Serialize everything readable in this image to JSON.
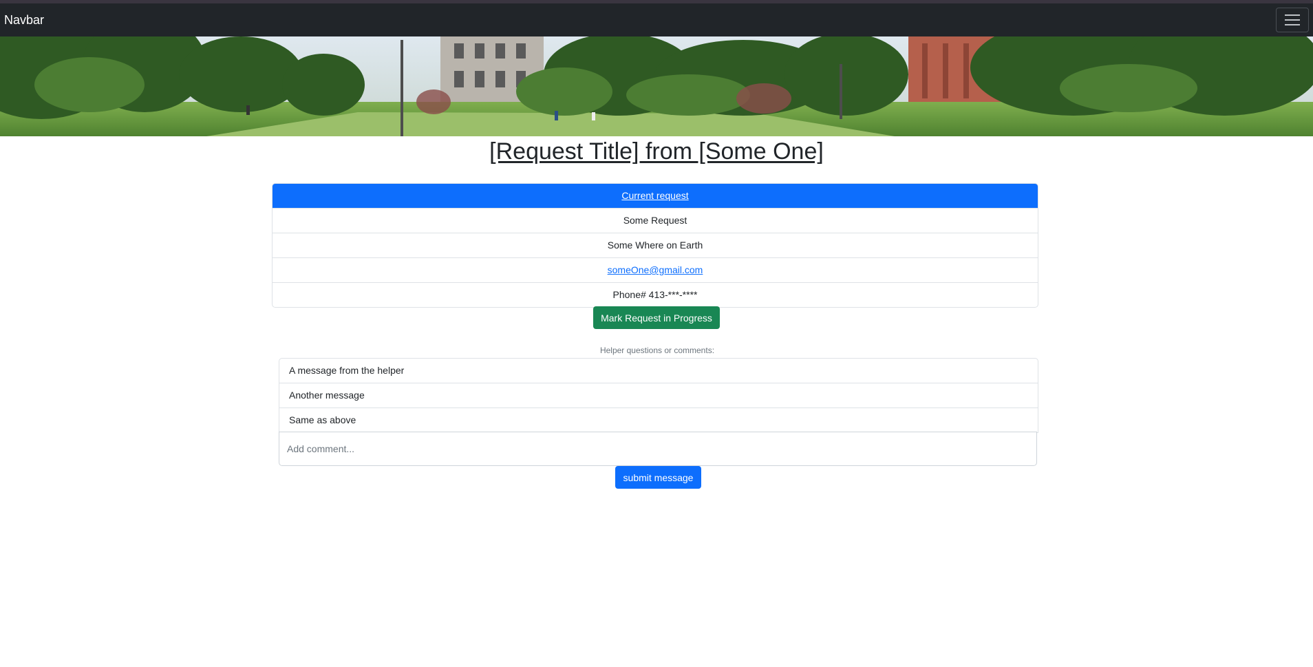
{
  "navbar": {
    "brand": "Navbar",
    "toggler_icon": "hamburger-menu-icon"
  },
  "banner": {
    "description_icon": "campus-photo"
  },
  "page": {
    "title": "[Request Title] from [Some One]"
  },
  "request": {
    "header_label": "Current request",
    "items": [
      "Some Request",
      "Some Where on Earth",
      "someOne@gmail.com",
      "Phone# 413-***-****"
    ]
  },
  "actions": {
    "mark_in_progress": "Mark Request in Progress"
  },
  "comments": {
    "label": "Helper questions or comments:",
    "messages": [
      "A message from the helper",
      "Another message",
      "Same as above"
    ],
    "input_placeholder": "Add comment...",
    "submit_label": "submit message"
  },
  "colors": {
    "navbar_bg": "#212529",
    "primary": "#0d6efd",
    "success": "#198754"
  }
}
